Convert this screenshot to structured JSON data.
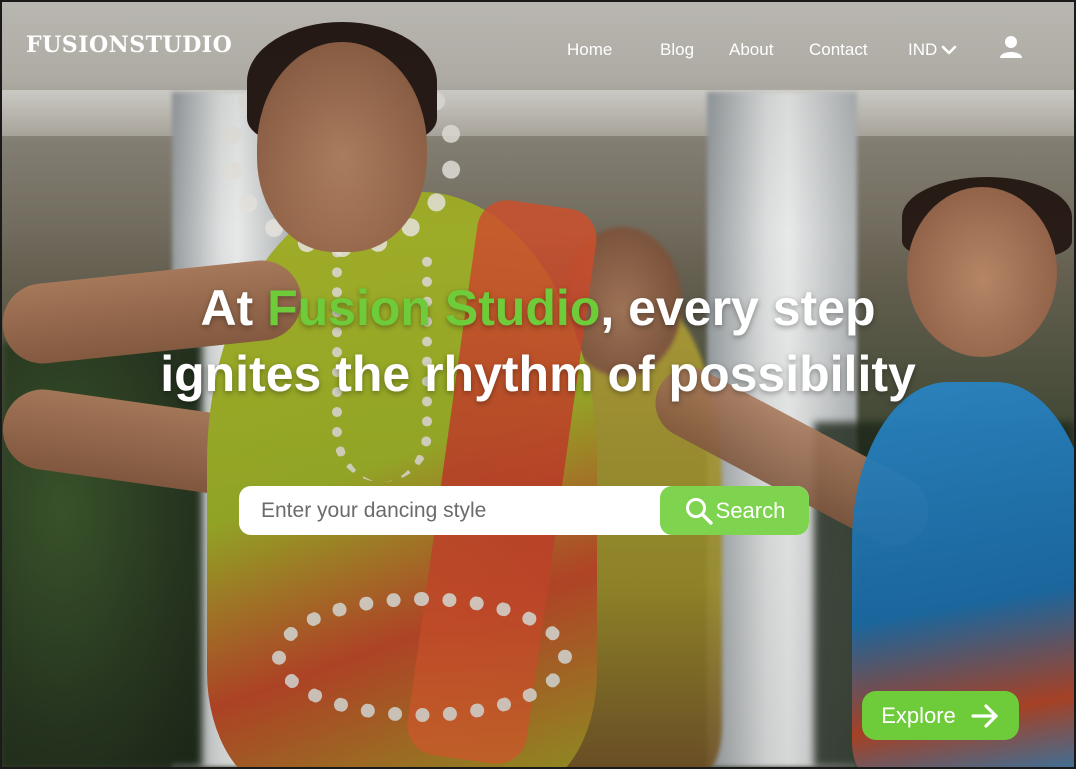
{
  "brand": {
    "logo_text": "FUSIONSTUDIO"
  },
  "nav": {
    "home": "Home",
    "blog": "Blog",
    "about": "About",
    "contact": "Contact",
    "region": "IND",
    "region_icon": "chevron-down-icon",
    "account_icon": "user-icon"
  },
  "hero": {
    "headline_prefix": "At ",
    "headline_accent": "Fusion Studio",
    "headline_suffix_line1": ", every step",
    "headline_line2": "ignites the rhythm of possibility"
  },
  "search": {
    "placeholder": "Enter your dancing style",
    "value": "",
    "button_label": "Search",
    "button_icon": "search-icon"
  },
  "cta": {
    "explore_label": "Explore",
    "explore_icon": "arrow-right-icon"
  },
  "colors": {
    "accent_green": "#6ecb3a",
    "button_green": "#7ed34f",
    "text_white": "#ffffff"
  }
}
